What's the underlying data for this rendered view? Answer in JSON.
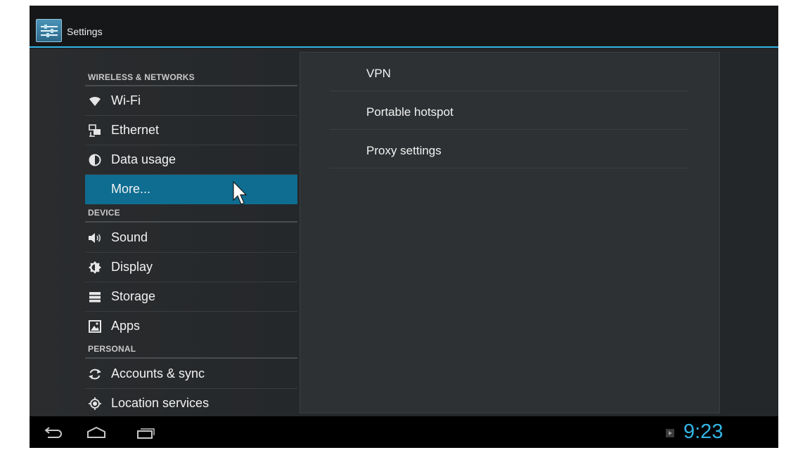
{
  "app": {
    "title": "Settings"
  },
  "sections": [
    {
      "header": "WIRELESS & NETWORKS",
      "items": [
        {
          "label": "Wi-Fi",
          "icon": "wifi-icon"
        },
        {
          "label": "Ethernet",
          "icon": "ethernet-icon"
        },
        {
          "label": "Data usage",
          "icon": "data-usage-icon"
        },
        {
          "label": "More...",
          "icon": "",
          "selected": true
        }
      ]
    },
    {
      "header": "DEVICE",
      "items": [
        {
          "label": "Sound",
          "icon": "sound-icon"
        },
        {
          "label": "Display",
          "icon": "display-icon"
        },
        {
          "label": "Storage",
          "icon": "storage-icon"
        },
        {
          "label": "Apps",
          "icon": "apps-icon"
        }
      ]
    },
    {
      "header": "PERSONAL",
      "items": [
        {
          "label": "Accounts & sync",
          "icon": "sync-icon"
        },
        {
          "label": "Location services",
          "icon": "location-icon"
        }
      ]
    }
  ],
  "detail": {
    "items": [
      {
        "label": "VPN"
      },
      {
        "label": "Portable hotspot"
      },
      {
        "label": "Proxy settings"
      }
    ]
  },
  "status": {
    "time": "9:23"
  },
  "colors": {
    "accent": "#33b5e5",
    "selected": "#0e6d91"
  }
}
